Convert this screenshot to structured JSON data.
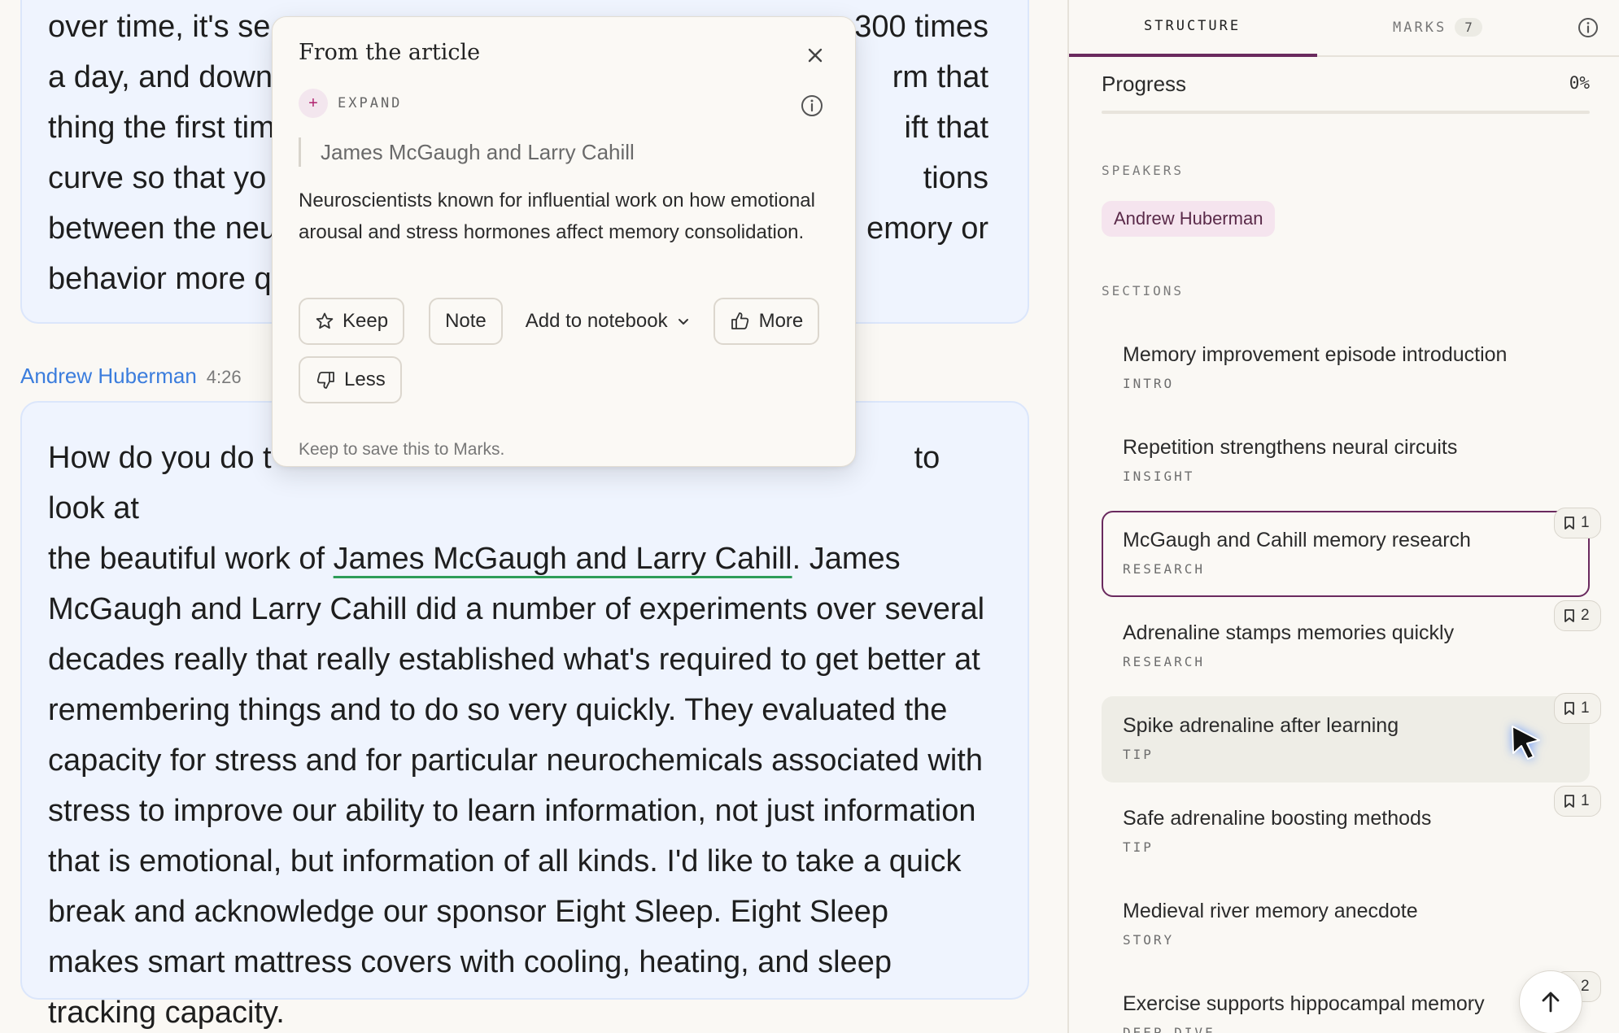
{
  "transcript": {
    "card1_text": "over time, it's se… …300 times a day, and down …rm that thing the first tim… …ift that curve so that yo… …tions between the neu… …emory or behavior more q…",
    "card1_lines": [
      "over time, it's se",
      "a day, and down",
      "thing the first tim",
      "curve so that yo",
      "between the neu",
      "behavior more q"
    ],
    "card1_right": [
      "300 times",
      "rm that",
      "ift that",
      "tions",
      "emory or",
      ""
    ],
    "speaker_name": "Andrew Huberman",
    "speaker_time": "4:26",
    "card2_before": "How do you do t",
    "card2_before_right": "to look at",
    "card2_line2_prefix": "the beautiful work of ",
    "card2_entity": "James McGaugh and Larry Cahill",
    "card2_rest": ". James McGaugh and Larry Cahill did a number of experiments over several decades really that really established what's required to get better at remembering things and to do so very quickly. They evaluated the capacity for stress and for particular neurochemicals associated with stress to improve our ability to learn information, not just information that is emotional, but information of all kinds. I'd like to take a quick break and acknowledge our sponsor Eight Sleep. Eight Sleep makes smart mattress covers with cooling, heating, and sleep tracking capacity."
  },
  "popover": {
    "title": "From the article",
    "expand_label": "EXPAND",
    "quote": "James McGaugh and Larry Cahill",
    "description": "Neuroscientists known for influential work on how emotional arousal and stress hormones affect memory consolidation.",
    "actions": {
      "keep": "Keep",
      "note": "Note",
      "add_to_notebook": "Add to notebook",
      "more": "More",
      "less": "Less"
    },
    "hint": "Keep to save this to Marks."
  },
  "sidebar": {
    "tabs": {
      "structure": "STRUCTURE",
      "marks": "MARKS",
      "marks_count": "7"
    },
    "progress_label": "Progress",
    "progress_value": "0%",
    "progress_fraction": 0,
    "speakers_heading": "SPEAKERS",
    "speakers": [
      "Andrew Huberman"
    ],
    "sections_heading": "SECTIONS",
    "sections": [
      {
        "title": "Memory improvement episode introduction",
        "tag": "INTRO",
        "marks": ""
      },
      {
        "title": "Repetition strengthens neural circuits",
        "tag": "INSIGHT",
        "marks": ""
      },
      {
        "title": "McGaugh and Cahill memory research",
        "tag": "RESEARCH",
        "marks": "1"
      },
      {
        "title": "Adrenaline stamps memories quickly",
        "tag": "RESEARCH",
        "marks": "2"
      },
      {
        "title": "Spike adrenaline after learning",
        "tag": "TIP",
        "marks": "1"
      },
      {
        "title": "Safe adrenaline boosting methods",
        "tag": "TIP",
        "marks": "1"
      },
      {
        "title": "Medieval river memory anecdote",
        "tag": "STORY",
        "marks": ""
      },
      {
        "title": "Exercise supports hippocampal memory",
        "tag": "DEEP DIVE",
        "marks": "2"
      }
    ]
  },
  "colors": {
    "accent": "#6a2a5e",
    "speaker_link": "#3b7ddd",
    "entity_underline": "#2e9d58",
    "card_bg": "#eff4fe"
  },
  "icons": [
    "close-icon",
    "plus-icon",
    "info-icon",
    "star-icon",
    "chevron-down-icon",
    "thumbs-up-icon",
    "thumbs-down-icon",
    "bookmark-icon",
    "arrow-up-icon",
    "cursor-pointer-icon"
  ]
}
